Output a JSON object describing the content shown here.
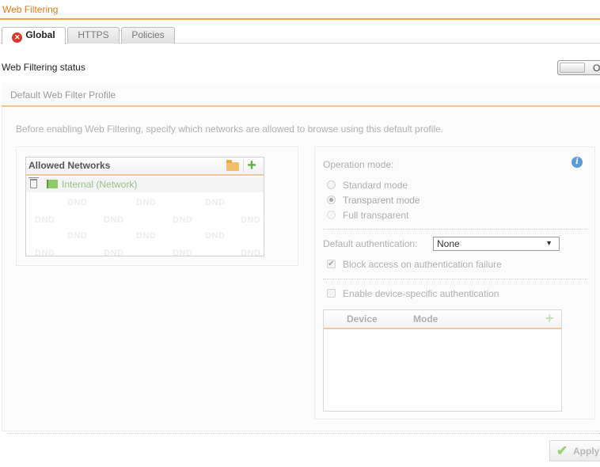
{
  "page": {
    "title": "Web Filtering"
  },
  "tabs": [
    {
      "label": "Global",
      "active": true,
      "icon": "error-icon"
    },
    {
      "label": "HTTPS",
      "active": false
    },
    {
      "label": "Policies",
      "active": false
    }
  ],
  "status": {
    "label": "Web Filtering status",
    "toggle_text": "O",
    "enabled": false
  },
  "section": {
    "title": "Default Web Filter Profile",
    "description": "Before enabling Web Filtering, specify which networks are allowed to browse using this default profile."
  },
  "allowed_networks": {
    "title": "Allowed Networks",
    "items": [
      {
        "label": "Internal (Network)"
      }
    ],
    "watermark": "DND"
  },
  "operation": {
    "label": "Operation mode:",
    "options": [
      {
        "label": "Standard mode",
        "selected": false
      },
      {
        "label": "Transparent mode",
        "selected": true
      },
      {
        "label": "Full transparent",
        "selected": false
      }
    ]
  },
  "auth": {
    "label": "Default authentication:",
    "selected": "None",
    "block_label": "Block access on authentication failure",
    "block_checked": true,
    "device_label": "Enable device-specific authentication",
    "device_checked": false
  },
  "device_table": {
    "columns": [
      "Device",
      "Mode"
    ]
  },
  "buttons": {
    "apply": "Apply"
  },
  "colors": {
    "accent": "#e8780f",
    "accent_rule": "#f2a24e",
    "error": "#d63a2a",
    "add_green": "#5cb03a",
    "info": "#5a9bd8"
  }
}
